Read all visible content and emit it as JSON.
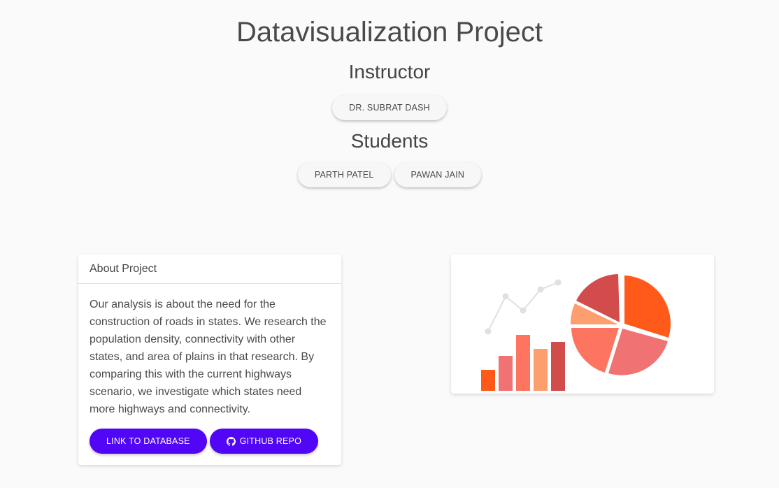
{
  "header": {
    "title": "Datavisualization Project",
    "instructor_heading": "Instructor",
    "instructor": "DR. SUBRAT DASH",
    "students_heading": "Students",
    "students": [
      "PARTH PATEL",
      "PAWAN JAIN"
    ]
  },
  "about": {
    "heading": "About Project",
    "text": "Our analysis is about the need for the construction of roads in states. We research the population density, connectivity with other states, and area of plains in that research. By comparing this with the current highways scenario, we investigate which states need more highways and connectivity.",
    "database_button": "LINK TO DATABASE",
    "github_button": "GITHUB REPO",
    "github_icon": "github-icon"
  },
  "colors": {
    "accent": "#5106f5",
    "background": "#fafafa",
    "illustration": [
      "#ff5a1a",
      "#f07272",
      "#fd7560",
      "#fd9e6e",
      "#d24c4c"
    ]
  }
}
